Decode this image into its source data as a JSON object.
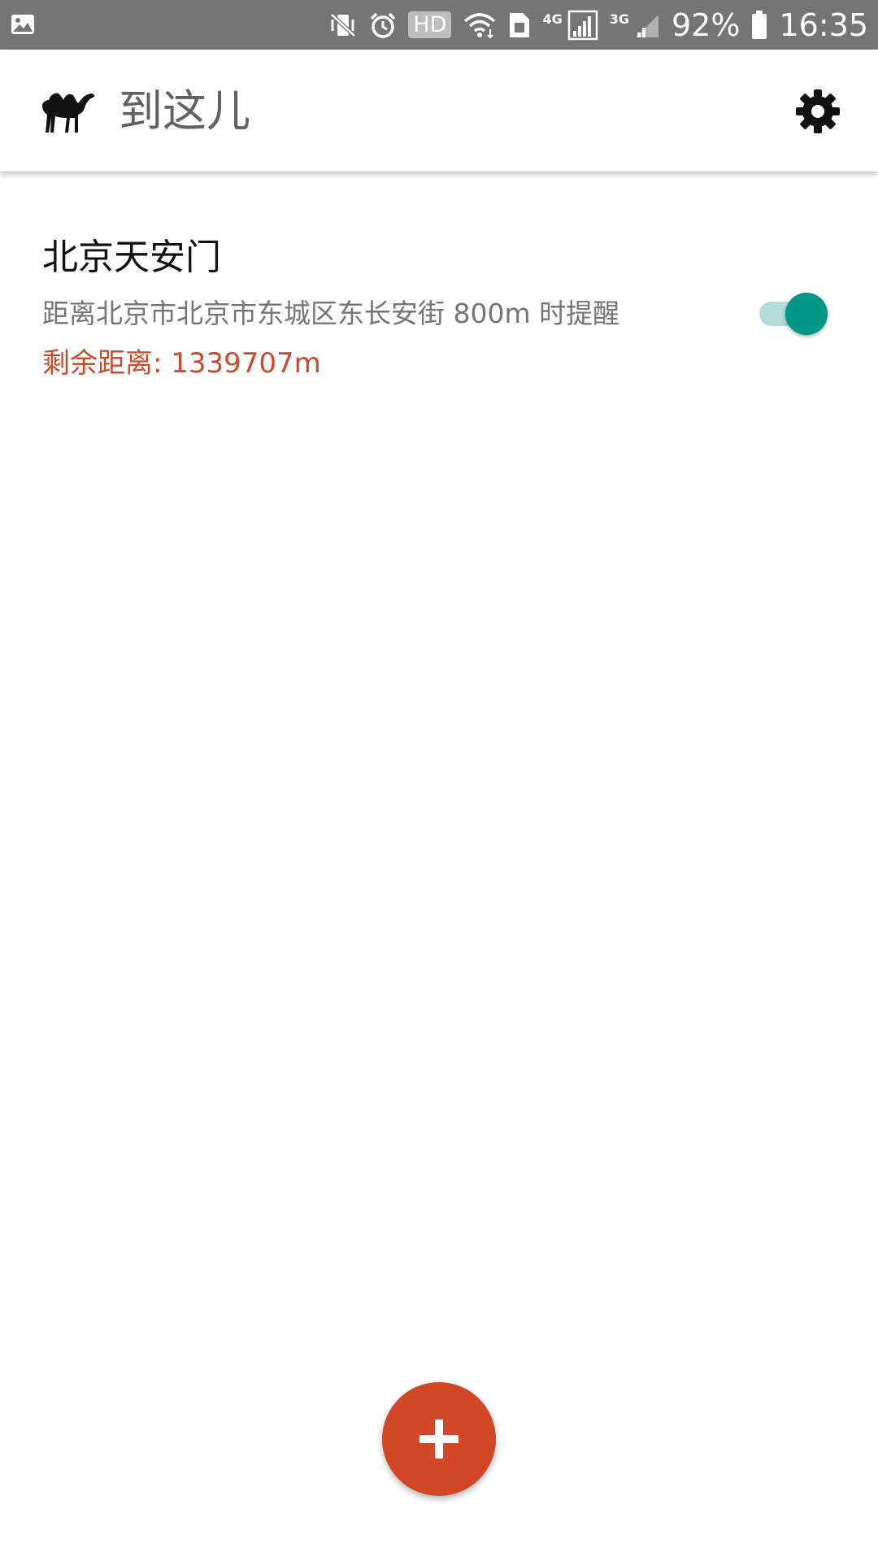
{
  "status_bar": {
    "left_icons": [
      "image-icon"
    ],
    "right_icons": [
      "mute-vibrate-icon",
      "alarm-icon",
      "hd-badge",
      "wifi-icon",
      "sim-icon",
      "signal-4g-icon",
      "signal-3g-icon"
    ],
    "hd_label": "HD",
    "signal_4g_label": "4G",
    "signal_3g_label": "3G",
    "battery_percent": "92%",
    "time": "16:35"
  },
  "app_bar": {
    "title": "到这儿",
    "logo_icon": "camel-icon",
    "settings_icon": "gear-icon"
  },
  "reminders": [
    {
      "title": "北京天安门",
      "description": "距离北京市北京市东城区东长安街 800m 时提醒",
      "remaining": "剩余距离: 1339707m",
      "enabled": true
    }
  ],
  "fab": {
    "icon": "plus-icon"
  },
  "colors": {
    "status_bar": "#757575",
    "accent": "#009688",
    "fab": "#d24726",
    "remaining_text": "#cc4a2a"
  }
}
